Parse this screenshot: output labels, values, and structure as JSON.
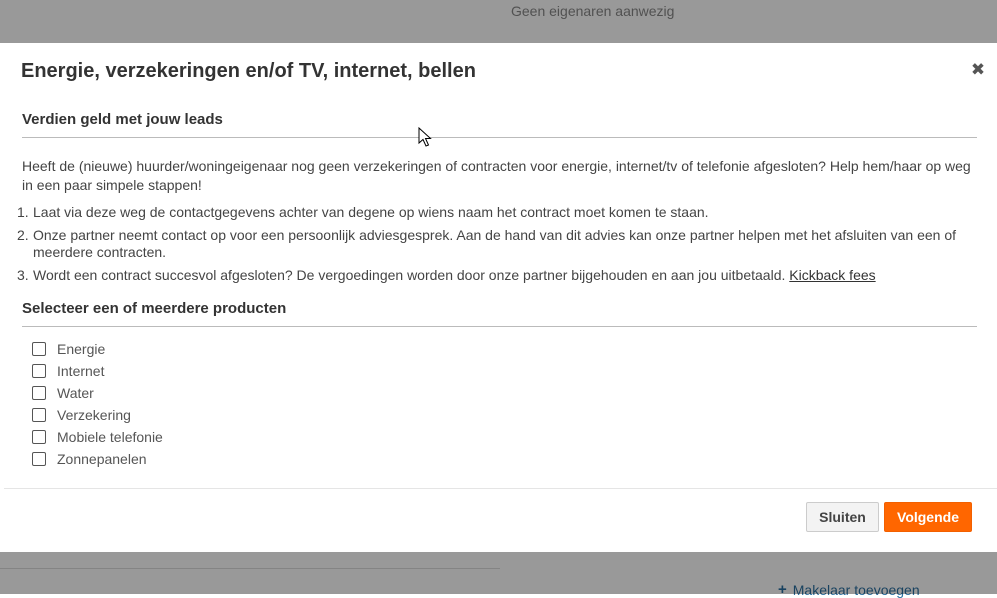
{
  "background": {
    "owners_text": "Geen eigenaren aanwezig",
    "partial_text": "| | | |",
    "add_broker_label": "Makelaar toevoegen"
  },
  "modal": {
    "title": "Energie, verzekeringen en/of TV, internet, bellen",
    "close_icon": "close-icon",
    "section1_heading": "Verdien geld met jouw leads",
    "intro": "Heeft de (nieuwe) huurder/woningeigenaar nog geen verzekeringen of contracten voor energie, internet/tv of telefonie afgesloten? Help hem/haar op weg in een paar simpele stappen!",
    "steps": [
      "Laat via deze weg de contactgegevens achter van degene op wiens naam het contract moet komen te staan.",
      "Onze partner neemt contact op voor een persoonlijk adviesgesprek. Aan de hand van dit advies kan onze partner helpen met het afsluiten van een of meerdere contracten.",
      "Wordt een contract succesvol afgesloten? De vergoedingen worden door onze partner bijgehouden en aan jou uitbetaald."
    ],
    "kickback_link": "Kickback fees",
    "section2_heading": "Selecteer een of meerdere producten",
    "products": [
      "Energie",
      "Internet",
      "Water",
      "Verzekering",
      "Mobiele telefonie",
      "Zonnepanelen"
    ],
    "buttons": {
      "close": "Sluiten",
      "next": "Volgende"
    }
  },
  "colors": {
    "accent": "#ff6600",
    "overlay": "rgba(0,0,0,0.40)"
  }
}
